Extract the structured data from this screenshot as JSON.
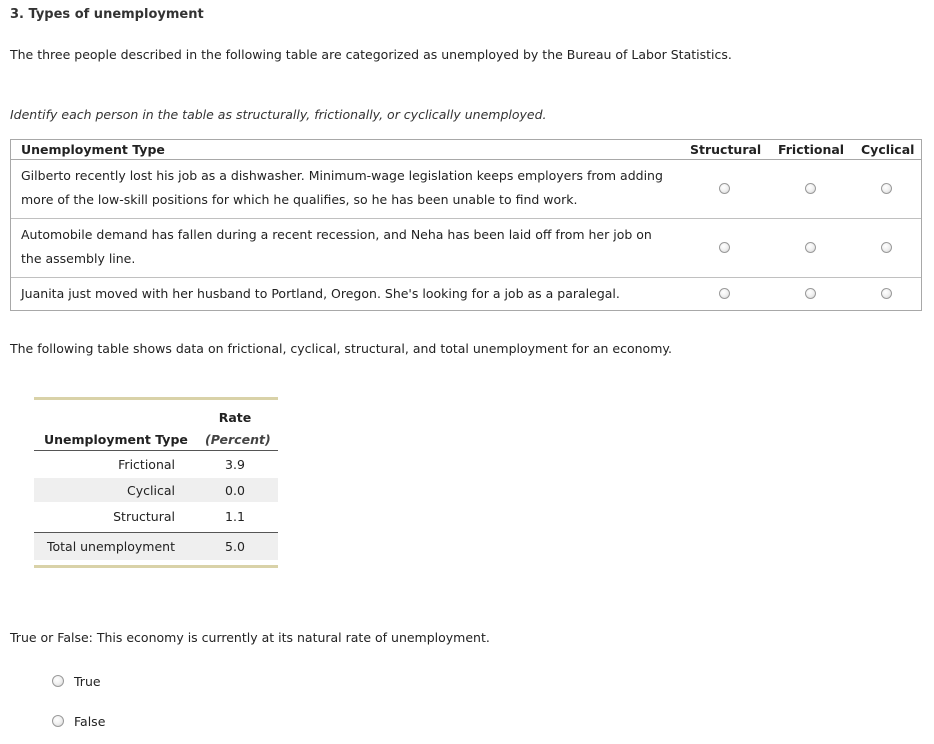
{
  "question": {
    "title": "3. Types of unemployment",
    "intro": "The three people described in the following table are categorized as unemployed by the Bureau of Labor Statistics.",
    "instruction": "Identify each person in the table as structurally, frictionally, or cyclically unemployed."
  },
  "classify_table": {
    "headers": {
      "type": "Unemployment Type",
      "structural": "Structural",
      "frictional": "Frictional",
      "cyclical": "Cyclical"
    },
    "rows": [
      {
        "text": "Gilberto recently lost his job as a dishwasher. Minimum-wage legislation keeps employers from adding more of the low-skill positions for which he qualifies, so he has been unable to find work."
      },
      {
        "text": "Automobile demand has fallen during a recent recession, and Neha has been laid off from her job on the assembly line."
      },
      {
        "text": "Juanita just moved with her husband to Portland, Oregon. She's looking for a job as a paralegal."
      }
    ]
  },
  "data_intro": "The following table shows data on frictional, cyclical, structural, and total unemployment for an economy.",
  "data_table": {
    "col_type": "Unemployment Type",
    "col_rate": "Rate",
    "col_rate_unit": "(Percent)",
    "rows": [
      {
        "label": "Frictional",
        "value": "3.9"
      },
      {
        "label": "Cyclical",
        "value": "0.0"
      },
      {
        "label": "Structural",
        "value": "1.1"
      }
    ],
    "total": {
      "label": "Total unemployment",
      "value": "5.0"
    }
  },
  "true_false": {
    "question": "True or False: This economy is currently at its natural rate of unemployment.",
    "options": [
      "True",
      "False"
    ]
  }
}
